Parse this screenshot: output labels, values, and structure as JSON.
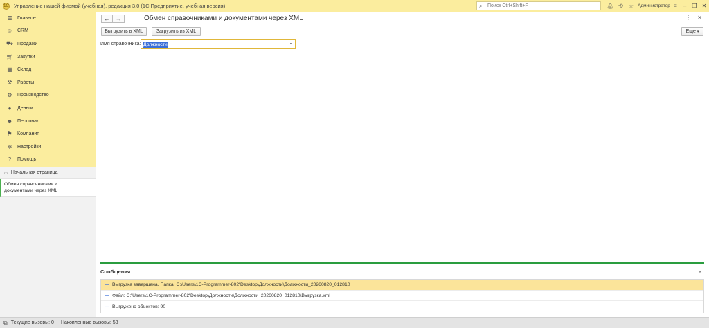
{
  "window": {
    "title": "Управление нашей фирмой (учебная), редакция 3.0  (1С:Предприятие, учебная версия)",
    "search_placeholder": "Поиск Ctrl+Shift+F",
    "user": "Администратор"
  },
  "sidebar": {
    "items": [
      {
        "label": "Главное",
        "icon": "menu-icon"
      },
      {
        "label": "CRM",
        "icon": "crm-icon"
      },
      {
        "label": "Продажи",
        "icon": "sales-icon"
      },
      {
        "label": "Закупки",
        "icon": "purchases-icon"
      },
      {
        "label": "Склад",
        "icon": "warehouse-icon"
      },
      {
        "label": "Работы",
        "icon": "works-icon"
      },
      {
        "label": "Производство",
        "icon": "production-icon"
      },
      {
        "label": "Деньги",
        "icon": "money-icon"
      },
      {
        "label": "Персонал",
        "icon": "personnel-icon"
      },
      {
        "label": "Компания",
        "icon": "company-icon"
      },
      {
        "label": "Настройки",
        "icon": "settings-icon"
      },
      {
        "label": "Помощь",
        "icon": "help-icon"
      }
    ],
    "home_label": "Начальная страница",
    "open_doc_line1": "Обмен справочниками и",
    "open_doc_line2": "документами через XML"
  },
  "form": {
    "title": "Обмен справочниками и документами через XML",
    "export_button": "Выгрузить в XML",
    "import_button": "Загрузить из XML",
    "more_button": "Еще",
    "field_label": "Имя справочника:",
    "field_value": "Должности"
  },
  "messages": {
    "title": "Сообщения:",
    "rows": [
      "Выгрузка завершена. Папка: C:\\Users\\1C-Programmer-802\\Desktop\\Должности\\Должности_20260820_012810",
      "Файл: C:\\Users\\1C-Programmer-802\\Desktop\\Должности\\Должности_20260820_012810\\Выгрузка.xml",
      "Выгружено объектов: 90"
    ]
  },
  "status": {
    "current_calls": "Текущие вызовы:  0",
    "accumulated_calls": "Накопленные вызовы:  58"
  }
}
